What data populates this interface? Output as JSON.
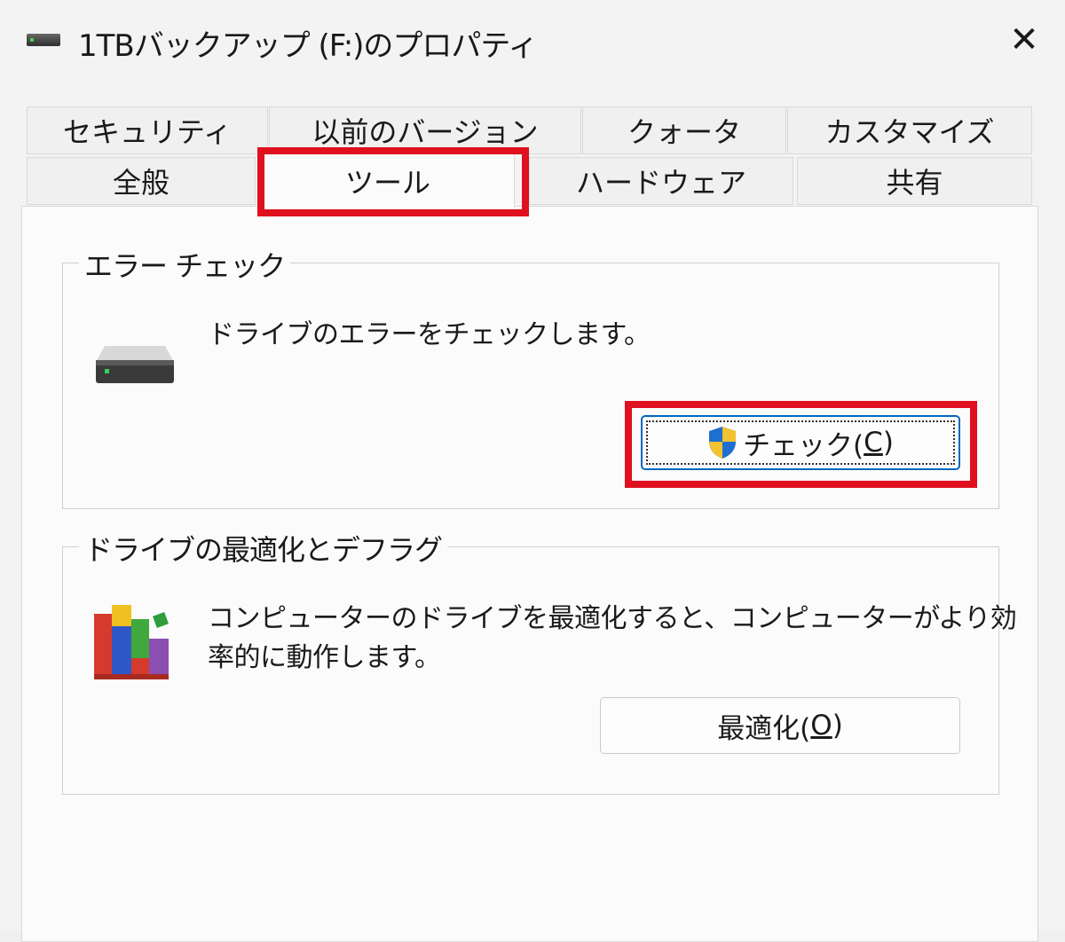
{
  "window": {
    "title": "1TBバックアップ (F:)のプロパティ",
    "close_label": "✕"
  },
  "tabs": {
    "row_top": [
      {
        "label": "セキュリティ"
      },
      {
        "label": "以前のバージョン"
      },
      {
        "label": "クォータ"
      },
      {
        "label": "カスタマイズ"
      }
    ],
    "row_bottom": [
      {
        "label": "全般"
      },
      {
        "label": "ツール",
        "active": true
      },
      {
        "label": "ハードウェア"
      },
      {
        "label": "共有"
      }
    ]
  },
  "error_check": {
    "group_label": "エラー チェック",
    "description": "ドライブのエラーをチェックします。",
    "button_label": "チェック(",
    "button_accel": "C",
    "button_close": ")"
  },
  "optimize": {
    "group_label": "ドライブの最適化とデフラグ",
    "description_line1": "コンピューターのドライブを最適化すると、コンピューターがより効",
    "description_line2": "率的に動作します。",
    "button_label": "最適化(",
    "button_accel": "O",
    "button_close": ")"
  },
  "icons": {
    "title": "drive-icon",
    "drive": "hard-drive-icon",
    "defrag": "defrag-icon",
    "shield": "uac-shield-icon"
  },
  "colors": {
    "highlight": "#e0101e",
    "focus": "#0067c0"
  }
}
